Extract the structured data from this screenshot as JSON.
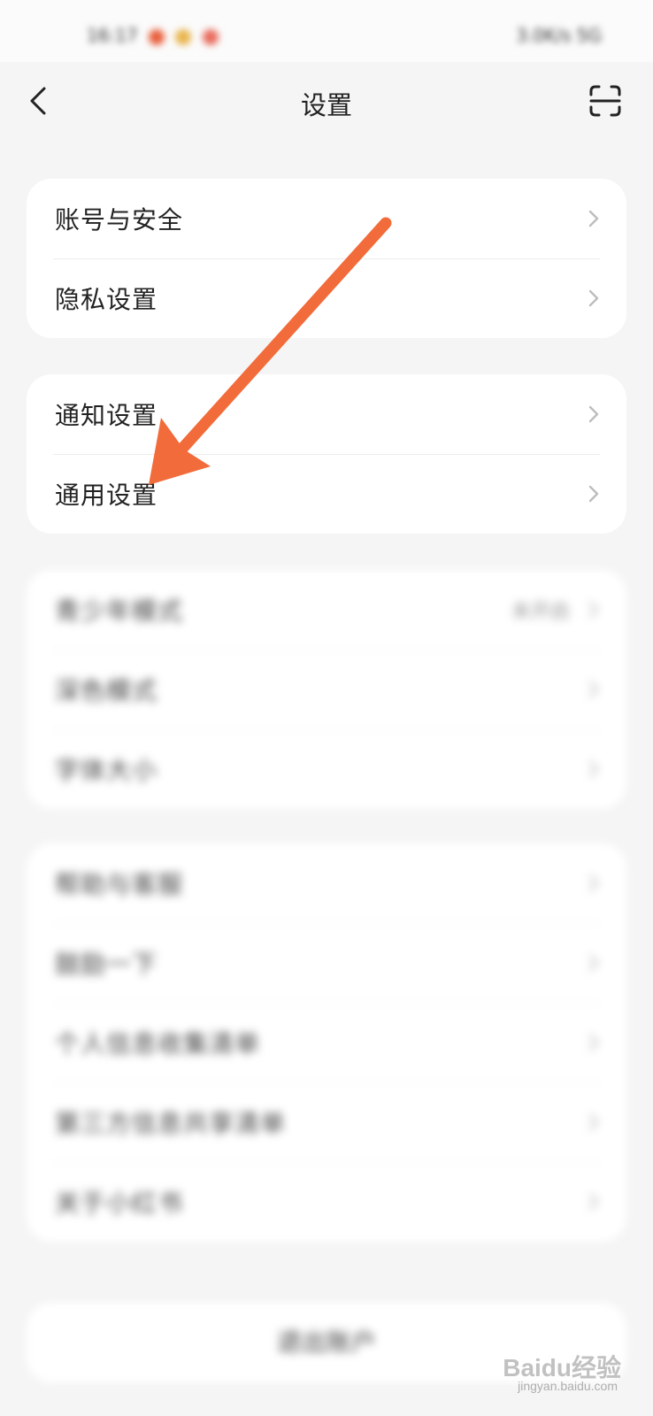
{
  "status_bar": {
    "time": "16:17",
    "right": "3.0K/s 5G"
  },
  "header": {
    "title": "设置"
  },
  "groups": [
    {
      "items": [
        {
          "label": "账号与安全"
        },
        {
          "label": "隐私设置"
        }
      ]
    },
    {
      "items": [
        {
          "label": "通知设置"
        },
        {
          "label": "通用设置"
        }
      ]
    },
    {
      "items": [
        {
          "label": "青少年模式",
          "value": "未开启"
        },
        {
          "label": "深色模式"
        },
        {
          "label": "字体大小"
        }
      ]
    },
    {
      "items": [
        {
          "label": "帮助与客服"
        },
        {
          "label": "鼓励一下"
        },
        {
          "label": "个人信息收集清单"
        },
        {
          "label": "第三方信息共享清单"
        },
        {
          "label": "关于小红书"
        }
      ]
    }
  ],
  "logout_label": "退出账户",
  "annotation_arrow_color": "#f26b3a",
  "watermark": {
    "brand": "Baidu经验",
    "url": "jingyan.baidu.com"
  }
}
